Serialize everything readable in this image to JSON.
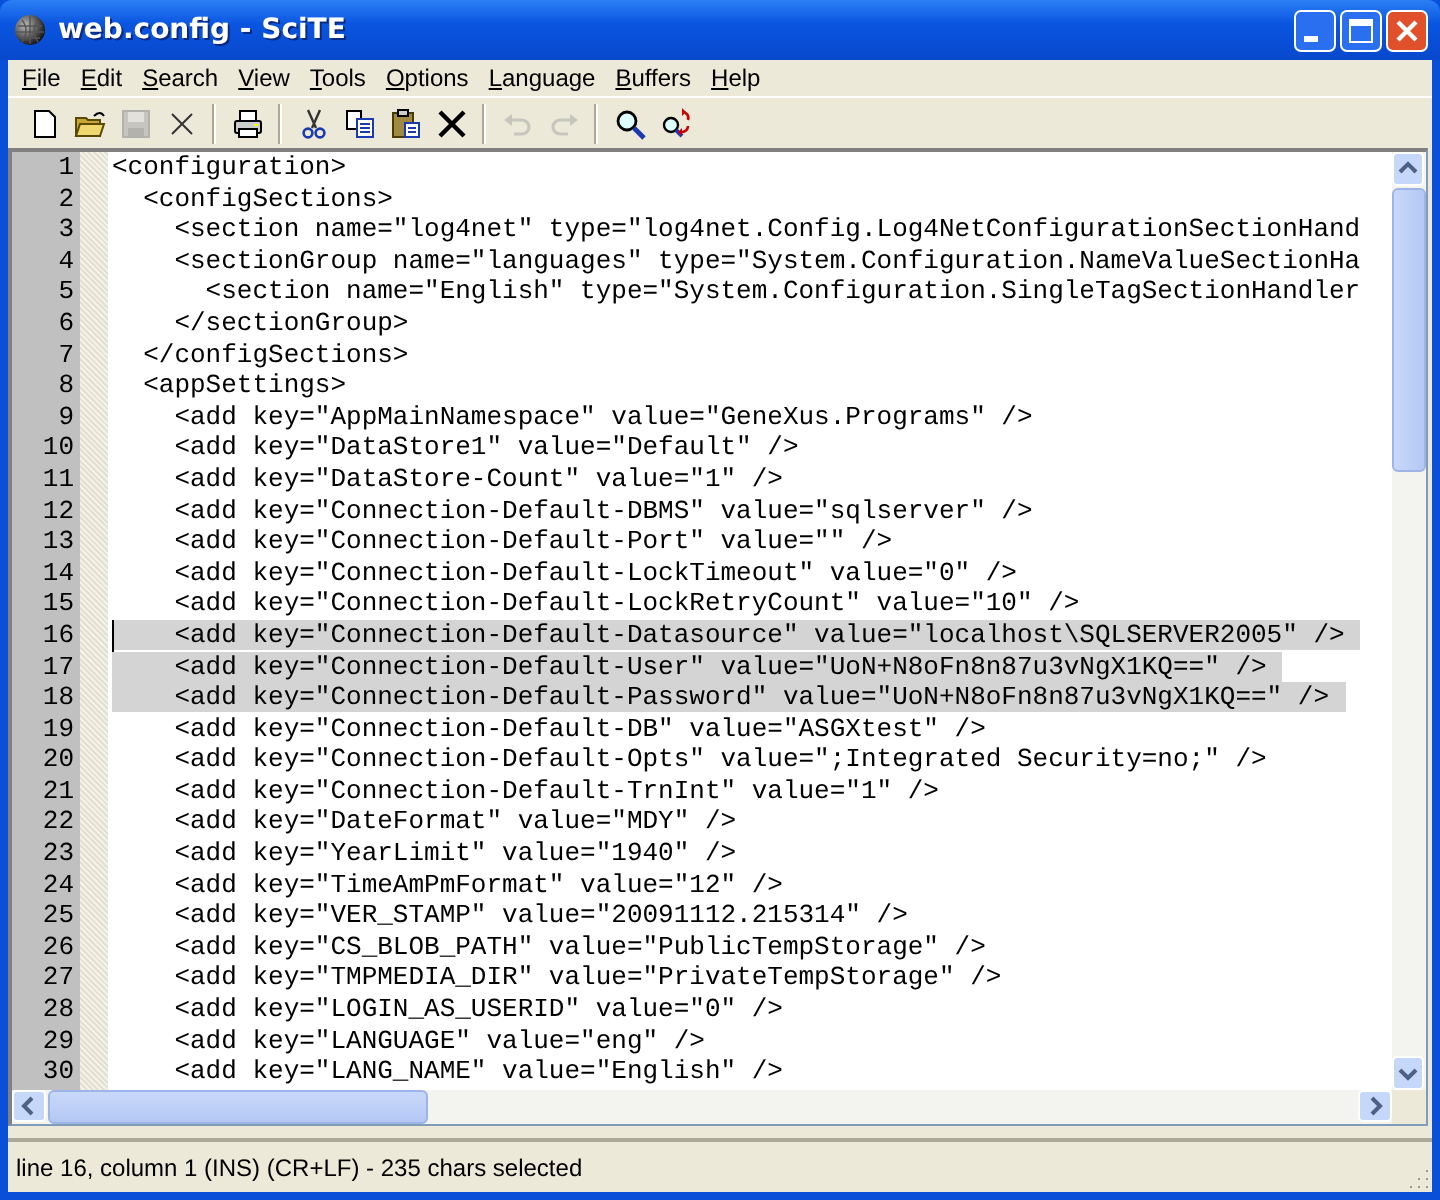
{
  "window": {
    "title": "web.config - SciTE"
  },
  "menu": [
    "File",
    "Edit",
    "Search",
    "View",
    "Tools",
    "Options",
    "Language",
    "Buffers",
    "Help"
  ],
  "toolbar": [
    {
      "kind": "new",
      "disabled": false
    },
    {
      "kind": "open",
      "disabled": false
    },
    {
      "kind": "save",
      "disabled": true
    },
    {
      "kind": "close",
      "disabled": false
    },
    {
      "kind": "sep"
    },
    {
      "kind": "print",
      "disabled": false
    },
    {
      "kind": "sep"
    },
    {
      "kind": "cut",
      "disabled": false
    },
    {
      "kind": "copy",
      "disabled": false
    },
    {
      "kind": "paste",
      "disabled": false
    },
    {
      "kind": "delete",
      "disabled": false
    },
    {
      "kind": "sep"
    },
    {
      "kind": "undo",
      "disabled": true
    },
    {
      "kind": "redo",
      "disabled": true
    },
    {
      "kind": "sep"
    },
    {
      "kind": "find",
      "disabled": false
    },
    {
      "kind": "replace",
      "disabled": false
    }
  ],
  "editor": {
    "lines": [
      {
        "number": "1",
        "text": "<configuration>",
        "selected": false
      },
      {
        "number": "2",
        "text": "  <configSections>",
        "selected": false
      },
      {
        "number": "3",
        "text": "    <section name=\"log4net\" type=\"log4net.Config.Log4NetConfigurationSectionHand",
        "selected": false
      },
      {
        "number": "4",
        "text": "    <sectionGroup name=\"languages\" type=\"System.Configuration.NameValueSectionHa",
        "selected": false
      },
      {
        "number": "5",
        "text": "      <section name=\"English\" type=\"System.Configuration.SingleTagSectionHandler",
        "selected": false
      },
      {
        "number": "6",
        "text": "    </sectionGroup>",
        "selected": false
      },
      {
        "number": "7",
        "text": "  </configSections>",
        "selected": false
      },
      {
        "number": "8",
        "text": "  <appSettings>",
        "selected": false
      },
      {
        "number": "9",
        "text": "    <add key=\"AppMainNamespace\" value=\"GeneXus.Programs\" />",
        "selected": false
      },
      {
        "number": "10",
        "text": "    <add key=\"DataStore1\" value=\"Default\" />",
        "selected": false
      },
      {
        "number": "11",
        "text": "    <add key=\"DataStore-Count\" value=\"1\" />",
        "selected": false
      },
      {
        "number": "12",
        "text": "    <add key=\"Connection-Default-DBMS\" value=\"sqlserver\" />",
        "selected": false
      },
      {
        "number": "13",
        "text": "    <add key=\"Connection-Default-Port\" value=\"\" />",
        "selected": false
      },
      {
        "number": "14",
        "text": "    <add key=\"Connection-Default-LockTimeout\" value=\"0\" />",
        "selected": false
      },
      {
        "number": "15",
        "text": "    <add key=\"Connection-Default-LockRetryCount\" value=\"10\" />",
        "selected": false
      },
      {
        "number": "16",
        "text": "    <add key=\"Connection-Default-Datasource\" value=\"localhost\\SQLSERVER2005\" />",
        "selected": true,
        "caret": true
      },
      {
        "number": "17",
        "text": "    <add key=\"Connection-Default-User\" value=\"UoN+N8oFn8n87u3vNgX1KQ==\" />",
        "selected": true
      },
      {
        "number": "18",
        "text": "    <add key=\"Connection-Default-Password\" value=\"UoN+N8oFn8n87u3vNgX1KQ==\" />",
        "selected": true
      },
      {
        "number": "19",
        "text": "    <add key=\"Connection-Default-DB\" value=\"ASGXtest\" />",
        "selected": false
      },
      {
        "number": "20",
        "text": "    <add key=\"Connection-Default-Opts\" value=\";Integrated Security=no;\" />",
        "selected": false
      },
      {
        "number": "21",
        "text": "    <add key=\"Connection-Default-TrnInt\" value=\"1\" />",
        "selected": false
      },
      {
        "number": "22",
        "text": "    <add key=\"DateFormat\" value=\"MDY\" />",
        "selected": false
      },
      {
        "number": "23",
        "text": "    <add key=\"YearLimit\" value=\"1940\" />",
        "selected": false
      },
      {
        "number": "24",
        "text": "    <add key=\"TimeAmPmFormat\" value=\"12\" />",
        "selected": false
      },
      {
        "number": "25",
        "text": "    <add key=\"VER_STAMP\" value=\"20091112.215314\" />",
        "selected": false
      },
      {
        "number": "26",
        "text": "    <add key=\"CS_BLOB_PATH\" value=\"PublicTempStorage\" />",
        "selected": false
      },
      {
        "number": "27",
        "text": "    <add key=\"TMPMEDIA_DIR\" value=\"PrivateTempStorage\" />",
        "selected": false
      },
      {
        "number": "28",
        "text": "    <add key=\"LOGIN_AS_USERID\" value=\"0\" />",
        "selected": false
      },
      {
        "number": "29",
        "text": "    <add key=\"LANGUAGE\" value=\"eng\" />",
        "selected": false
      },
      {
        "number": "30",
        "text": "    <add key=\"LANG_NAME\" value=\"English\" />",
        "selected": false
      }
    ]
  },
  "status_bar": "line 16, column 1 (INS) (CR+LF)  -  235 chars selected"
}
